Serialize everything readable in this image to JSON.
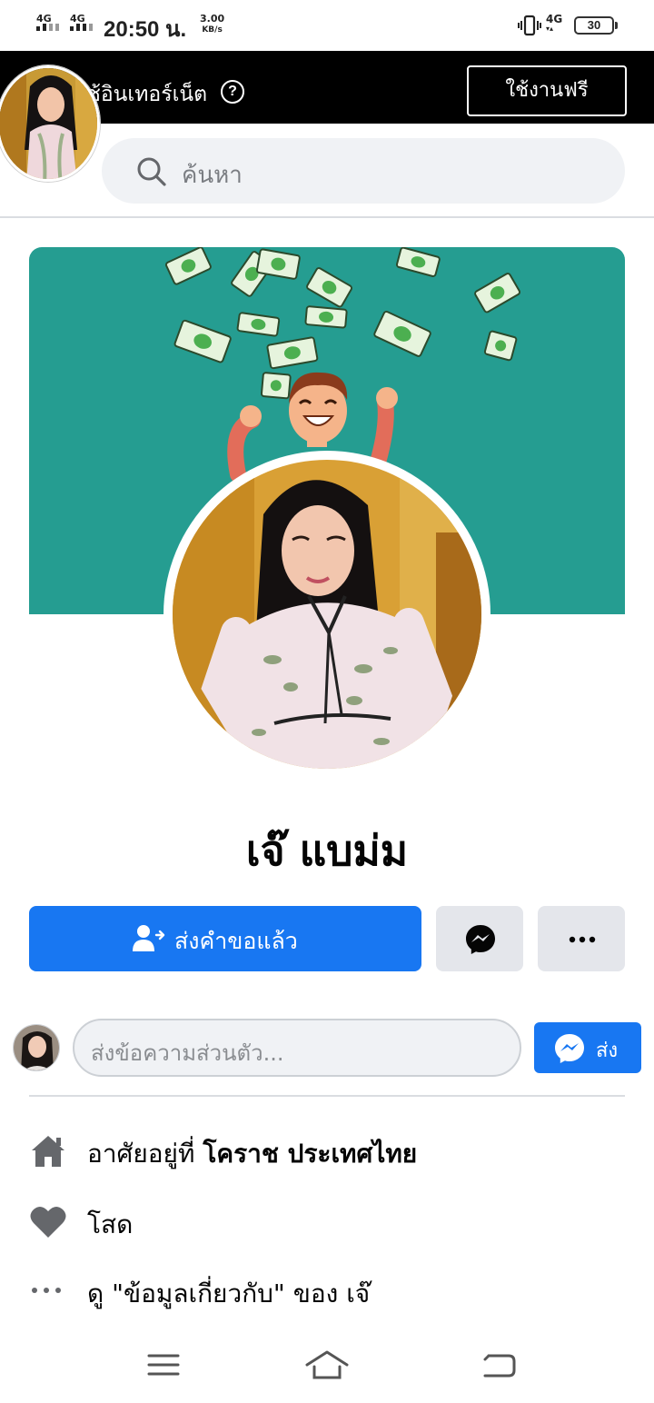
{
  "status_bar": {
    "signal1": "4G",
    "signal2": "4G",
    "time": "20:50 น.",
    "speed_value": "3.00",
    "speed_unit": "KB/s",
    "network": "4G",
    "battery": "30"
  },
  "data_banner": {
    "text": "ใช้อินเทอร์เน็ต",
    "help_icon": "question-circle-icon",
    "free_button_label": "ใช้งานฟรี"
  },
  "search": {
    "placeholder": "ค้นหา",
    "icon": "search-icon"
  },
  "profile": {
    "name": "เจ๊ แบม่ม",
    "cover_color": "#259d91"
  },
  "actions": {
    "request_sent_label": "ส่งคำขอแล้ว",
    "request_icon": "user-request-icon",
    "messenger_icon": "messenger-icon",
    "more_icon": "more-dots-icon",
    "primary_color": "#1877f2"
  },
  "message": {
    "placeholder": "ส่งข้อความส่วนตัว...",
    "send_label": "ส่ง"
  },
  "intro": {
    "lives_prefix": "อาศัยอยู่ที่",
    "lives_place": "โคราช ประเทศไทย",
    "relationship": "โสด",
    "see_about": "ดู \"ข้อมูลเกี่ยวกับ\" ของ เจ๊"
  },
  "nav": {
    "menu_icon": "menu-icon",
    "home_icon": "home-nav-icon",
    "back_icon": "back-icon"
  }
}
